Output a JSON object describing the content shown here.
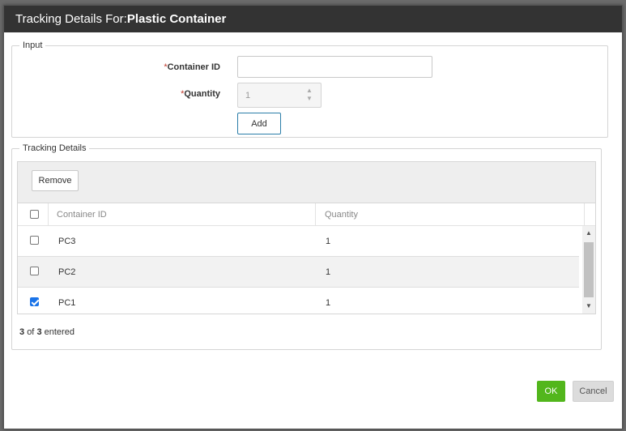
{
  "dialog": {
    "title_prefix": "Tracking Details For:",
    "title_item": "Plastic Container"
  },
  "input_section": {
    "legend": "Input",
    "container_id": {
      "required_mark": "*",
      "label": "Container ID",
      "value": ""
    },
    "quantity": {
      "required_mark": "*",
      "label": "Quantity",
      "value": "1"
    },
    "add_label": "Add"
  },
  "tracking_section": {
    "legend": "Tracking Details",
    "remove_label": "Remove",
    "columns": [
      "Container ID",
      "Quantity"
    ],
    "rows": [
      {
        "container_id": "PC3",
        "quantity": "1",
        "checked": false
      },
      {
        "container_id": "PC2",
        "quantity": "1",
        "checked": false
      },
      {
        "container_id": "PC1",
        "quantity": "1",
        "checked": true
      }
    ],
    "count_shown": "3",
    "count_of": "of",
    "count_total": "3",
    "count_suffix": "entered"
  },
  "buttons": {
    "ok": "OK",
    "cancel": "Cancel"
  },
  "colors": {
    "titlebar": "#333333",
    "ok": "#52b61c",
    "add_border": "#2a7da8",
    "checkbox": "#1a73e8"
  },
  "icons": {
    "spin_up": "triangle-up",
    "spin_down": "triangle-down",
    "scroll_up": "triangle-up",
    "scroll_down": "triangle-down"
  }
}
